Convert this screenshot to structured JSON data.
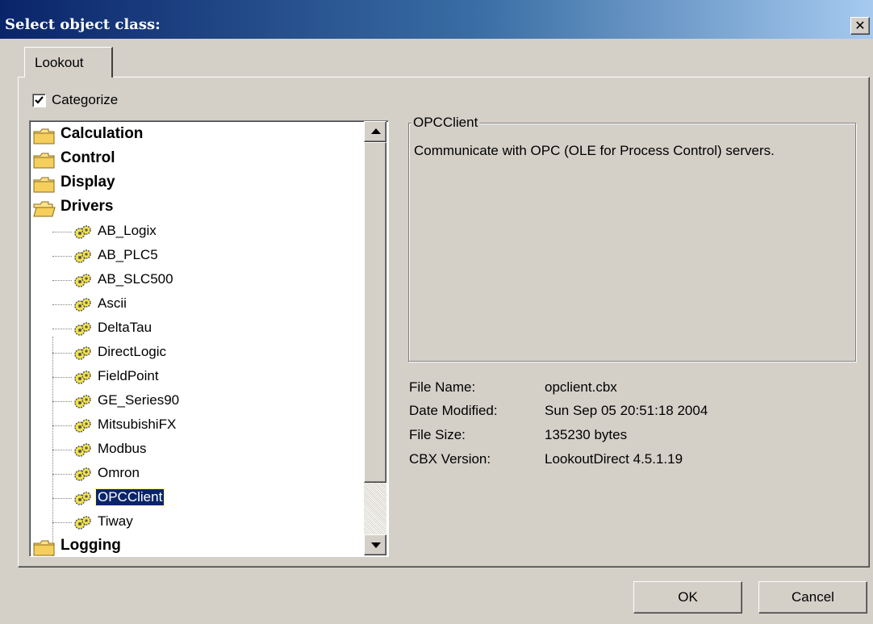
{
  "window": {
    "title": "Select object class:",
    "close_glyph": "✕"
  },
  "tabs": [
    {
      "label": "Lookout",
      "active": true
    }
  ],
  "categorize": {
    "label": "Categorize",
    "checked": true
  },
  "tree": {
    "folders": [
      {
        "label": "Calculation",
        "icon": "folder-closed-icon"
      },
      {
        "label": "Control",
        "icon": "folder-closed-icon"
      },
      {
        "label": "Display",
        "icon": "folder-closed-icon"
      },
      {
        "label": "Drivers",
        "icon": "folder-open-icon"
      },
      {
        "label": "Logging",
        "icon": "folder-closed-icon"
      }
    ],
    "drivers": [
      {
        "label": "AB_Logix"
      },
      {
        "label": "AB_PLC5"
      },
      {
        "label": "AB_SLC500"
      },
      {
        "label": "Ascii"
      },
      {
        "label": "DeltaTau"
      },
      {
        "label": "DirectLogic"
      },
      {
        "label": "FieldPoint"
      },
      {
        "label": "GE_Series90"
      },
      {
        "label": "MitsubishiFX"
      },
      {
        "label": "Modbus"
      },
      {
        "label": "Omron"
      },
      {
        "label": "OPCClient",
        "selected": true
      },
      {
        "label": "Tiway"
      }
    ]
  },
  "details": {
    "group_title": "OPCClient",
    "description": "Communicate with OPC (OLE for Process Control) servers.",
    "fields": [
      {
        "label": "File Name:",
        "value": "opclient.cbx"
      },
      {
        "label": "Date Modified:",
        "value": "Sun Sep 05 20:51:18 2004"
      },
      {
        "label": "File Size:",
        "value": "135230 bytes"
      },
      {
        "label": "CBX Version:",
        "value": "LookoutDirect 4.5.1.19"
      }
    ]
  },
  "buttons": {
    "ok": "OK",
    "cancel": "Cancel"
  },
  "colors": {
    "titlebar_start": "#0a246a",
    "titlebar_end": "#a6caf0",
    "selection": "#0a246a",
    "face": "#d4d0c8"
  }
}
